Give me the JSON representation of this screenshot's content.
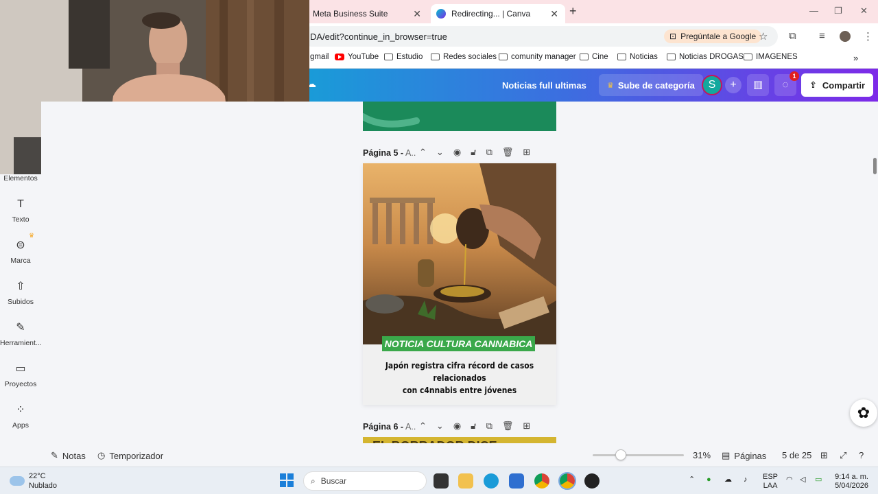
{
  "browser": {
    "tabs": [
      {
        "label": "Meta Business Suite"
      },
      {
        "label": "Redirecting... | Canva"
      }
    ],
    "url": "DA/edit?continue_in_browser=true",
    "ask_google": "Pregúntale a Google",
    "bookmarks": [
      {
        "label": "gmail"
      },
      {
        "label": "YouTube"
      },
      {
        "label": "Estudio"
      },
      {
        "label": "Redes sociales"
      },
      {
        "label": "comunity manager"
      },
      {
        "label": "Cine"
      },
      {
        "label": "Noticias"
      },
      {
        "label": "Noticias DROGAS"
      },
      {
        "label": "IMAGENES"
      }
    ]
  },
  "canva": {
    "doc_title": "Noticias full  ultimas",
    "upgrade_label": "Sube de categoría",
    "avatar_initial": "S",
    "comments_badge": "1",
    "share_label": "Compartir",
    "sidebar": [
      {
        "label": "Elementos"
      },
      {
        "label": "Texto"
      },
      {
        "label": "Marca"
      },
      {
        "label": "Subidos"
      },
      {
        "label": "Herramient..."
      },
      {
        "label": "Proyectos"
      },
      {
        "label": "Apps"
      }
    ],
    "page5": {
      "name": "Página 5 -",
      "subtitle": "A..",
      "tag": "NOTICIA CULTURA CANNABICA",
      "headline_1": "Japón registra cifra récord de casos relacionados",
      "headline_2": "con c4nnabis entre jóvenes"
    },
    "page6": {
      "name": "Página 6 -",
      "subtitle": "A..",
      "preview_text": "EL BORRADOR DICE:"
    },
    "bottom": {
      "notes": "Notas",
      "timer": "Temporizador",
      "zoom": "31%",
      "zoom_fraction": 0.31,
      "pages_label": "Páginas",
      "page_count": "5 de 25"
    }
  },
  "taskbar": {
    "temperature": "22°C",
    "weather": "Nublado",
    "search": "Buscar",
    "lang_1": "ESP",
    "lang_2": "LAA",
    "time": "9:14 a. m.",
    "date": "5/04/2026"
  },
  "colors": {
    "canva_gradient_start": "#1a9bd8",
    "canva_gradient_end": "#7d2ae8",
    "tag_green": "#3aa84a",
    "tab_strip": "#fbe3e6"
  }
}
